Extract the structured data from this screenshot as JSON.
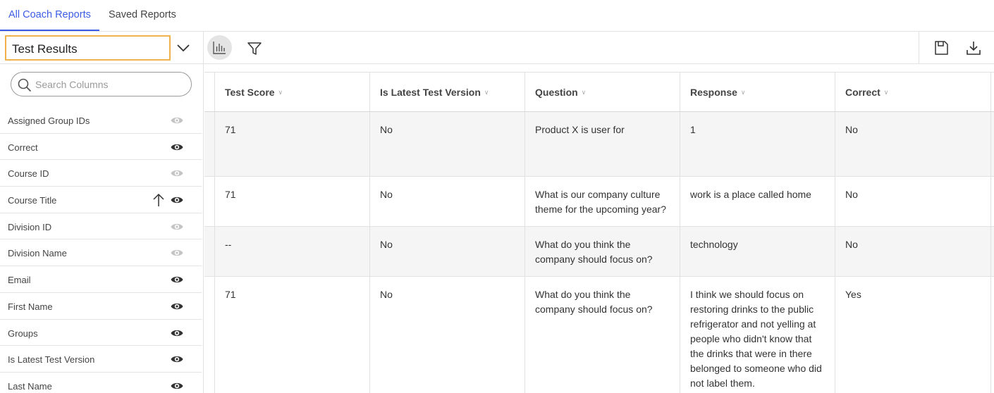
{
  "tabs": [
    {
      "label": "All Coach Reports",
      "active": true
    },
    {
      "label": "Saved Reports",
      "active": false
    }
  ],
  "toolbar": {
    "report_select": "Test Results",
    "chart_icon": "bar-chart-icon",
    "filter_icon": "filter-icon",
    "save_icon": "save-icon",
    "download_icon": "download-icon"
  },
  "sidebar": {
    "search_placeholder": "Search Columns",
    "columns": [
      {
        "label": "Assigned Group IDs",
        "visible": false
      },
      {
        "label": "Correct",
        "visible": true
      },
      {
        "label": "Course ID",
        "visible": false
      },
      {
        "label": "Course Title",
        "visible": true,
        "sorted": "ascending"
      },
      {
        "label": "Division ID",
        "visible": false
      },
      {
        "label": "Division Name",
        "visible": false
      },
      {
        "label": "Email",
        "visible": true
      },
      {
        "label": "First Name",
        "visible": true
      },
      {
        "label": "Groups",
        "visible": true
      },
      {
        "label": "Is Latest Test Version",
        "visible": true
      },
      {
        "label": "Last Name",
        "visible": true
      }
    ]
  },
  "table": {
    "headers": [
      "Test Score",
      "Is Latest Test Version",
      "Question",
      "Response",
      "Correct"
    ],
    "rows": [
      [
        "71",
        "No",
        "Product X is user for",
        "1",
        "No"
      ],
      [
        "71",
        "No",
        "What is our company culture theme for the upcoming year?",
        "work is a place called home",
        "No"
      ],
      [
        "--",
        "No",
        "What do you think the company should focus on?",
        "technology",
        "No"
      ],
      [
        "71",
        "No",
        "What do you think the company should focus on?",
        "I think we should focus on restoring drinks to the public refrigerator and not yelling at people who didn't know that the drinks that were in there belonged to someone who did not label them.",
        "Yes"
      ]
    ]
  },
  "colors": {
    "accent": "#3d5ce5",
    "select_border": "#f0b24d",
    "eye_on": "#333333",
    "eye_off": "#c4c4c4",
    "row_shade": "#f5f5f5"
  }
}
